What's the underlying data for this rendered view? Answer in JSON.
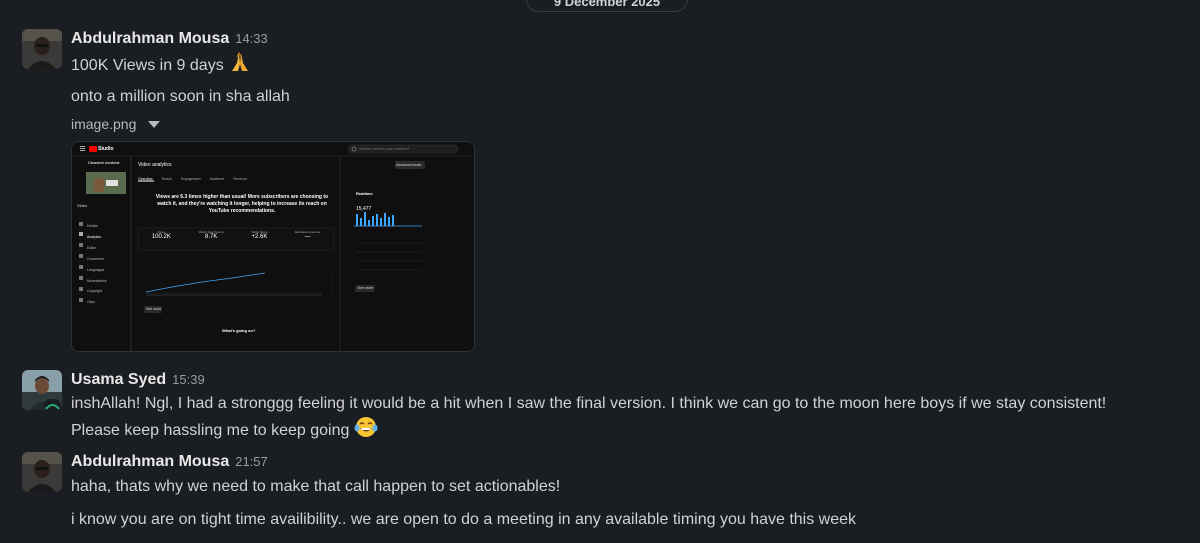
{
  "date_divider": "9 December 2025",
  "messages": [
    {
      "author": "Abdulrahman Mousa",
      "time": "14:33",
      "lines": [
        "100K Views in 9 days",
        "onto a million soon in sha allah"
      ],
      "emoji": "folded-hands",
      "attachment": {
        "filename": "image.png",
        "studio": {
          "logo_text": "Studio",
          "search_placeholder": "Search across your channel",
          "channel_label": "Channel content",
          "video_label": "Video",
          "nav_items": [
            "Details",
            "Analytics",
            "Editor",
            "Comments",
            "Languages",
            "Monetization",
            "Copyright",
            "Clips"
          ],
          "page_title": "Video analytics",
          "advanced_mode": "Advanced mode",
          "tabs": [
            "Overview",
            "Reach",
            "Engagement",
            "Audience",
            "Revenue"
          ],
          "headline": "Views are 6.3 times higher than usual! More subscribers are choosing to watch it, and they're watching it longer, helping to increase its reach on YouTube recommendations.",
          "metrics": [
            {
              "label": "Views",
              "value": "100.2K"
            },
            {
              "label": "Watch time (hours)",
              "value": "8.7K"
            },
            {
              "label": "Subscribers",
              "value": "+2.6K"
            },
            {
              "label": "Estimated revenue",
              "value": "—"
            }
          ],
          "see_more": "See more",
          "whats_going_on": "What's going on?",
          "realtime_title": "Realtime",
          "realtime_value": "15,477",
          "realtime_link": "See more"
        }
      }
    },
    {
      "author": "Usama Syed",
      "time": "15:39",
      "line1": "inshAllah! Ngl, I had a stronggg feeling it would be a hit when I saw the final version. I think we can go to the moon here boys if we stay consistent!",
      "line2": "Please keep hassling me to keep going",
      "emoji": "face-with-tears-of-joy"
    },
    {
      "author": "Abdulrahman Mousa",
      "time": "21:57",
      "lines": [
        "haha, thats why we need to make that call happen to set actionables!",
        "i know you are on tight time availibility.. we are open to do a meeting in any available timing you have this week"
      ]
    }
  ]
}
